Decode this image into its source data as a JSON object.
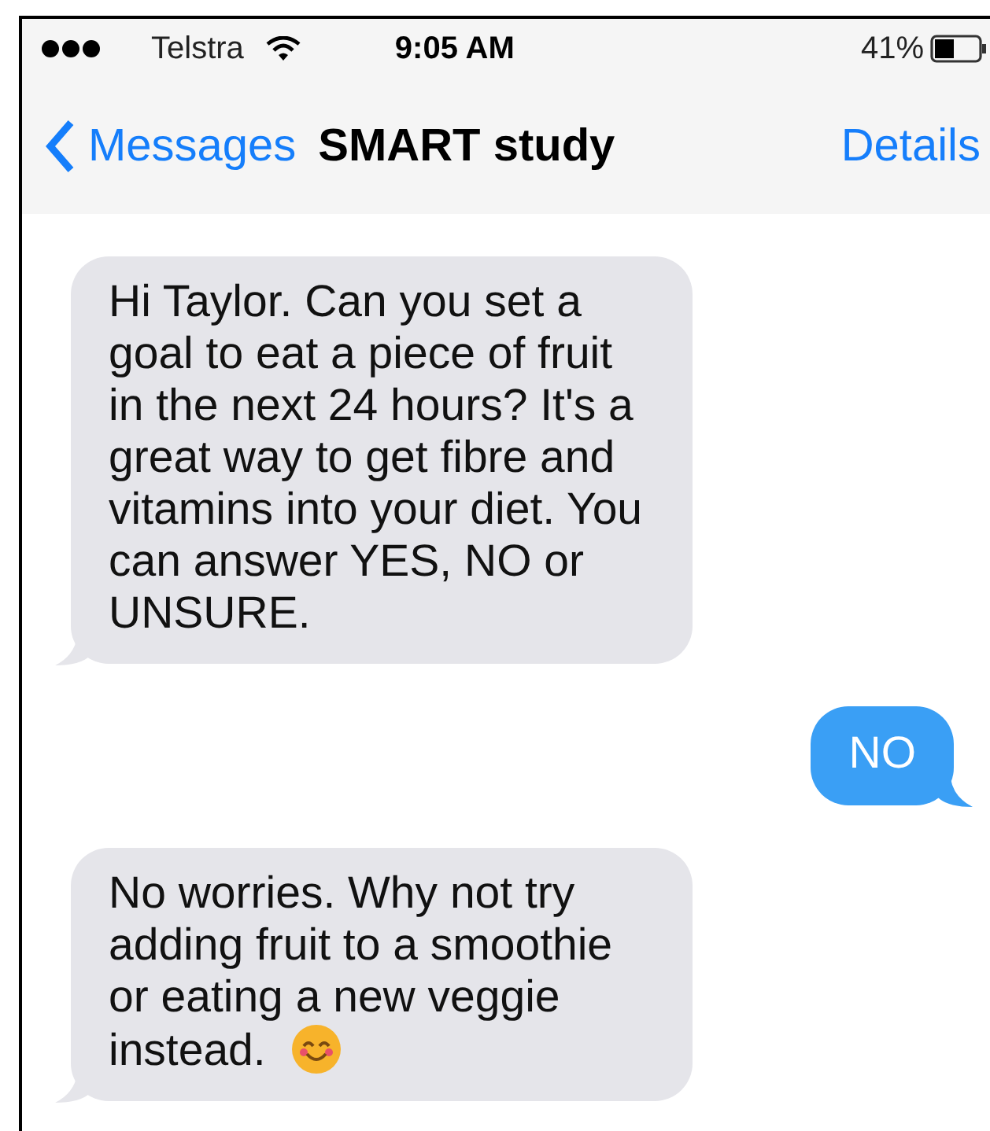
{
  "status_bar": {
    "carrier": "Telstra",
    "time": "9:05 AM",
    "battery": "41%"
  },
  "nav_bar": {
    "back": "Messages",
    "title": "SMART study",
    "action": "Details"
  },
  "messages": [
    {
      "kind": "received",
      "text": "Hi Taylor. Can you set a goal to eat a piece of fruit in the next 24 hours? It's a great way to get fibre and vitamins into your diet. You can answer YES, NO or UNSURE.",
      "emoji": false
    },
    {
      "kind": "sent",
      "text": "NO",
      "emoji": false
    },
    {
      "kind": "received",
      "text": "No worries. Why not try adding fruit to a smoothie or eating a new veggie instead.",
      "emoji": true
    }
  ]
}
